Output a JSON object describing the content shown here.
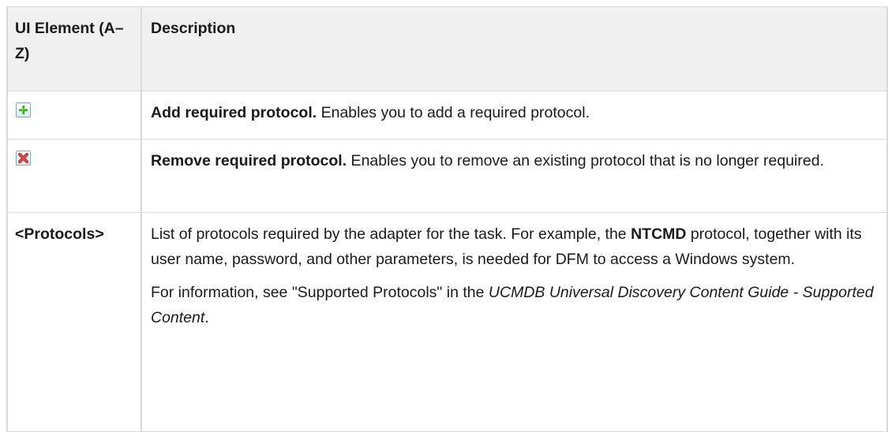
{
  "table": {
    "header": {
      "col1": "UI Element (A–Z)",
      "col2": "Description"
    },
    "rows": [
      {
        "icon": "add-plus-icon",
        "title": "Add required protocol.",
        "text": " Enables you to add a required protocol."
      },
      {
        "icon": "remove-x-icon",
        "title": "Remove required protocol.",
        "text": " Enables you to remove an existing protocol that is no longer required."
      },
      {
        "element": "<Protocols>",
        "p1_before": "List of protocols required by the adapter for the task. For example, the ",
        "p1_bold": "NTCMD",
        "p1_after": " protocol, together with its user name, password, and other parameters, is needed for DFM to access a Windows system.",
        "p2_before": "For information, see \"Supported Protocols\" in the ",
        "p2_italic": "UCMDB Universal Discovery Content Guide - Supported Content",
        "p2_after": "."
      }
    ]
  },
  "colors": {
    "border": "#d9d9d9",
    "header_bg": "#f0f0f0",
    "add_icon_green": "#3a9a2a",
    "remove_icon_red": "#d62b2b"
  }
}
